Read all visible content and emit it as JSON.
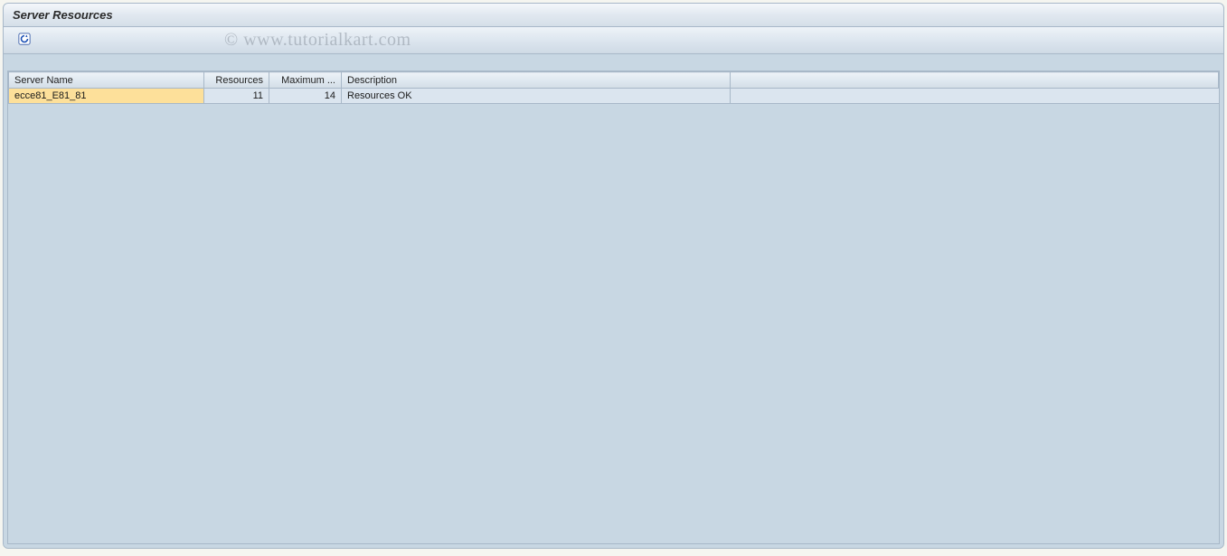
{
  "title": "Server Resources",
  "watermark": "© www.tutorialkart.com",
  "table": {
    "headers": {
      "server_name": "Server Name",
      "resources": "Resources",
      "maximum": "Maximum ...",
      "description": "Description"
    },
    "rows": [
      {
        "server_name": "ecce81_E81_81",
        "resources": "11",
        "maximum": "14",
        "description": "Resources OK",
        "selected": true
      }
    ]
  }
}
